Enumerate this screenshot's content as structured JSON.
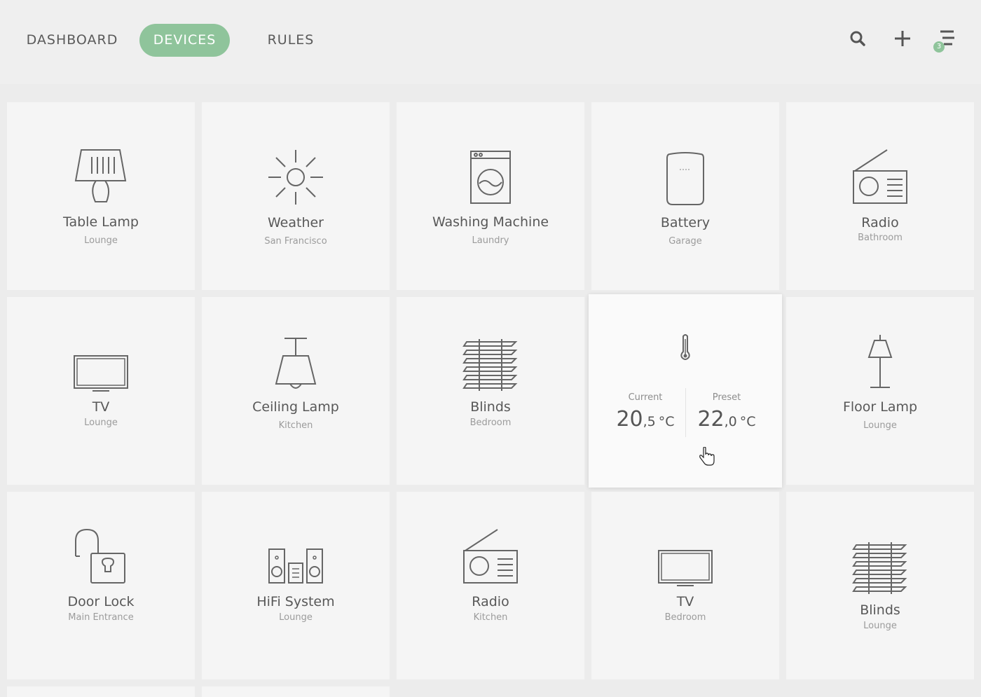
{
  "nav": {
    "tabs": [
      {
        "label": "DASHBOARD",
        "active": false
      },
      {
        "label": "DEVICES",
        "active": true
      },
      {
        "label": "RULES",
        "active": false
      }
    ]
  },
  "toolbar": {
    "search_icon": "search-icon",
    "add_icon": "plus-icon",
    "menu_icon": "menu-icon",
    "notification_count": "3"
  },
  "colors": {
    "accent": "#8fc49b",
    "tile": "#f5f5f5",
    "background": "#ececec"
  },
  "devices": [
    {
      "name": "Table Lamp",
      "location": "Lounge",
      "icon": "table-lamp-icon"
    },
    {
      "name": "Weather",
      "location": "San Francisco",
      "icon": "sun-icon"
    },
    {
      "name": "Washing Machine",
      "location": "Laundry",
      "icon": "washing-machine-icon"
    },
    {
      "name": "Battery",
      "location": "Garage",
      "icon": "battery-icon"
    },
    {
      "name": "Radio",
      "location": "Bathroom",
      "icon": "radio-icon"
    },
    {
      "name": "TV",
      "location": "Lounge",
      "icon": "tv-icon"
    },
    {
      "name": "Ceiling Lamp",
      "location": "Kitchen",
      "icon": "ceiling-lamp-icon"
    },
    {
      "name": "Blinds",
      "location": "Bedroom",
      "icon": "blinds-icon"
    },
    {
      "name": "Thermostat",
      "location": "",
      "icon": "thermometer-icon"
    },
    {
      "name": "Floor Lamp",
      "location": "Lounge",
      "icon": "floor-lamp-icon"
    },
    {
      "name": "Door Lock",
      "location": "Main Entrance",
      "icon": "padlock-icon"
    },
    {
      "name": "HiFi System",
      "location": "Lounge",
      "icon": "hifi-icon"
    },
    {
      "name": "Radio",
      "location": "Kitchen",
      "icon": "radio-icon"
    },
    {
      "name": "TV",
      "location": "Bedroom",
      "icon": "tv-icon"
    },
    {
      "name": "Blinds",
      "location": "Lounge",
      "icon": "blinds-icon"
    }
  ],
  "thermostat": {
    "current_label": "Current",
    "current_int": "20",
    "current_dec": ",5",
    "preset_label": "Preset",
    "preset_int": "22",
    "preset_dec": ",0",
    "unit": "°C"
  }
}
